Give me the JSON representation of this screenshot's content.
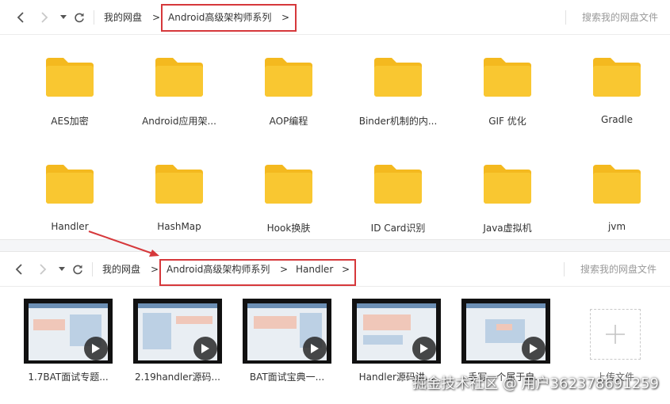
{
  "top": {
    "nav": {
      "back": "back-icon",
      "forward": "forward-icon",
      "dropdown": "chevron-down-icon",
      "refresh": "refresh-icon"
    },
    "breadcrumb": {
      "root": "我的网盘",
      "sep": ">",
      "items": [
        "Android高级架构师系列"
      ],
      "trailing_sep": ">"
    },
    "search_placeholder": "搜索我的网盘文件",
    "folders": [
      "AES加密",
      "Android应用架...",
      "AOP编程",
      "Binder机制的内...",
      "GIF 优化",
      "Gradle",
      "Handler",
      "HashMap",
      "Hook换肤",
      "ID Card识别",
      "Java虚拟机",
      "jvm"
    ]
  },
  "bottom": {
    "nav": {
      "back": "back-icon",
      "forward": "forward-icon",
      "dropdown": "chevron-down-icon",
      "refresh": "refresh-icon"
    },
    "breadcrumb": {
      "root": "我的网盘",
      "sep": ">",
      "items": [
        "Android高级架构师系列",
        "Handler"
      ],
      "trailing_sep": ">"
    },
    "search_placeholder": "搜索我的网盘文件",
    "videos": [
      "1.7BAT面试专题...",
      "2.19handler源码...",
      "BAT面试宝典一...",
      "Handler源码讲...",
      "手写一个属于自..."
    ],
    "upload_label": "上传文件"
  },
  "watermark": "掘金技术社区 @ 用户3623786912​59",
  "colors": {
    "folder": "#f9c731",
    "folder_tab": "#f4b91f",
    "highlight": "#d6383b"
  }
}
